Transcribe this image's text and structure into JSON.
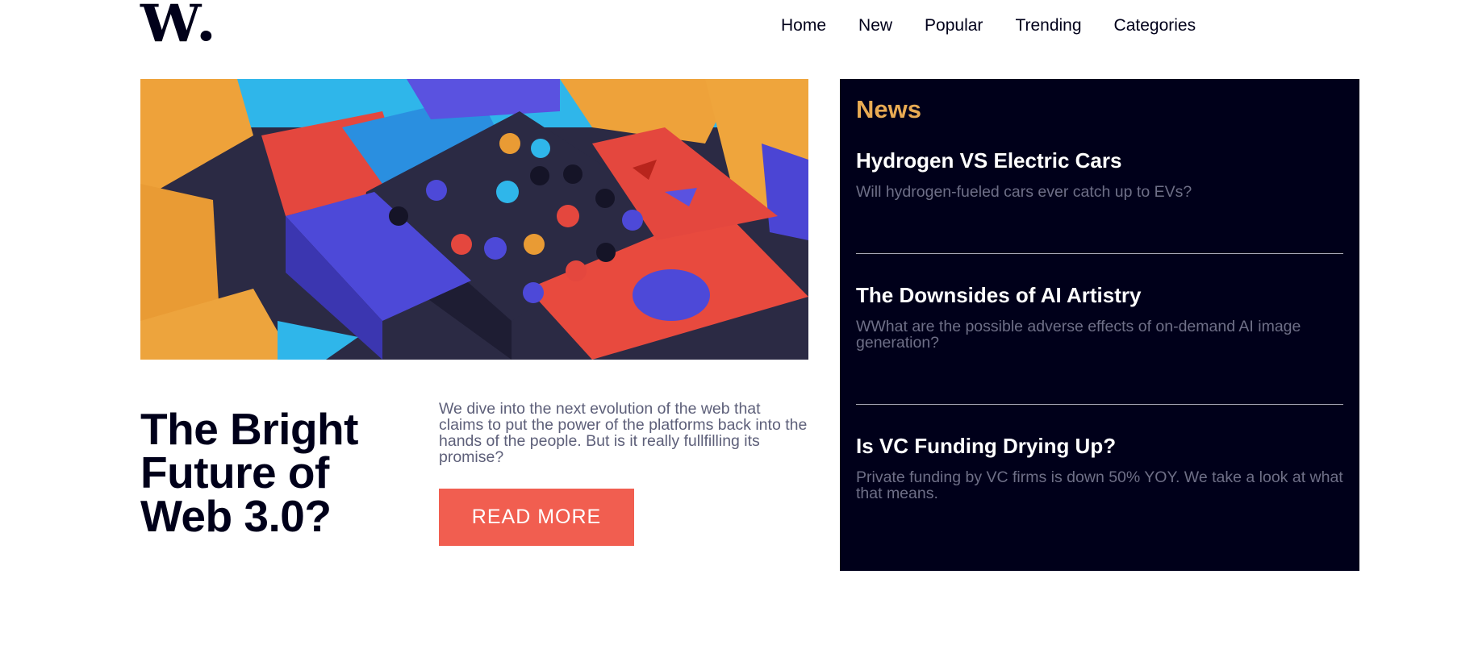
{
  "logo": {
    "text": "W"
  },
  "nav": {
    "items": [
      {
        "label": "Home"
      },
      {
        "label": "New"
      },
      {
        "label": "Popular"
      },
      {
        "label": "Trending"
      },
      {
        "label": "Categories"
      }
    ]
  },
  "hero": {
    "title": "The Bright Future of Web 3.0?",
    "description": "We dive into the next evolution of the web that claims to put the power of the platforms back into the hands of the people. But is it really fullfilling its promise?",
    "button_label": "READ MORE"
  },
  "news": {
    "heading": "News",
    "items": [
      {
        "title": "Hydrogen VS Electric Cars",
        "summary": "Will hydrogen-fueled cars ever catch up to EVs?"
      },
      {
        "title": "The Downsides of AI Artistry",
        "summary": "WWhat are the possible adverse effects of on-demand AI image generation?"
      },
      {
        "title": "Is VC Funding Drying Up?",
        "summary": "Private funding by VC firms is down 50% YOY. We take a look at what that means."
      }
    ]
  },
  "colors": {
    "primary_dark": "#00001a",
    "accent_orange": "#e9ab53",
    "accent_red": "#f15e50",
    "muted_text": "#5d5f79"
  }
}
